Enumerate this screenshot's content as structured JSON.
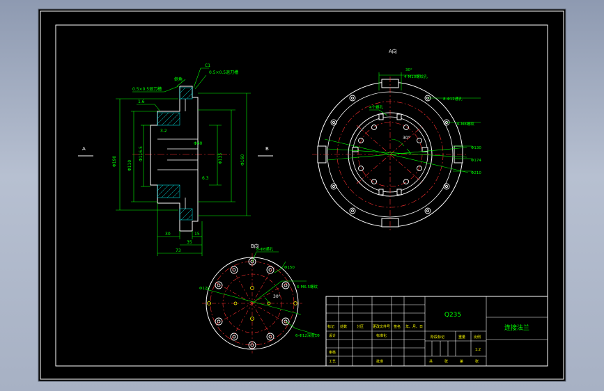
{
  "colors": {
    "paper": "#000000",
    "frame": "#ffffff",
    "dimension": "#00ff00",
    "hatch": "#00ffff",
    "center": "#ff3030",
    "leader": "#ffff00"
  },
  "view_labels": {
    "section_left": "A",
    "section_right": "B",
    "view_a": "A向",
    "view_b": "B向"
  },
  "section_view": {
    "dims": [
      "0.5×0.5退刀槽",
      "0.5×0.5退刀槽",
      "Φ190",
      "Φ110",
      "Φ135",
      "Φ160",
      "Φ40",
      "Φ116.5",
      "30",
      "15",
      "35",
      "73",
      "1.6",
      "3.2",
      "6.3",
      "倒角",
      "C1"
    ]
  },
  "view_a": {
    "dims": [
      "30°",
      "4-M10螺纹孔",
      "8-Φ12通孔",
      "6-M8螺纹",
      "Φ130",
      "Φ174",
      "Φ210",
      "4个螺孔",
      "30°"
    ]
  },
  "view_b": {
    "dims": [
      "8-Φ8通孔",
      "Φ150",
      "6-M6.5螺纹",
      "Φ120",
      "6-Φ12深度10",
      "30°"
    ]
  },
  "title_block": {
    "material": "Q235",
    "part_name": "连接法兰",
    "row_mark": [
      "标记",
      "处数",
      "分区",
      "更改文件号",
      "签名",
      "年、月、日"
    ],
    "row_design": [
      "设计",
      "标准化"
    ],
    "row_check": "审核",
    "row_process": [
      "工艺",
      "批准"
    ],
    "stage_label": "阶段标记",
    "weight_label": "重量",
    "scale_label": "比例",
    "scale_value": "1:2",
    "sheets_label": [
      "共",
      "张",
      "第",
      "张"
    ]
  }
}
